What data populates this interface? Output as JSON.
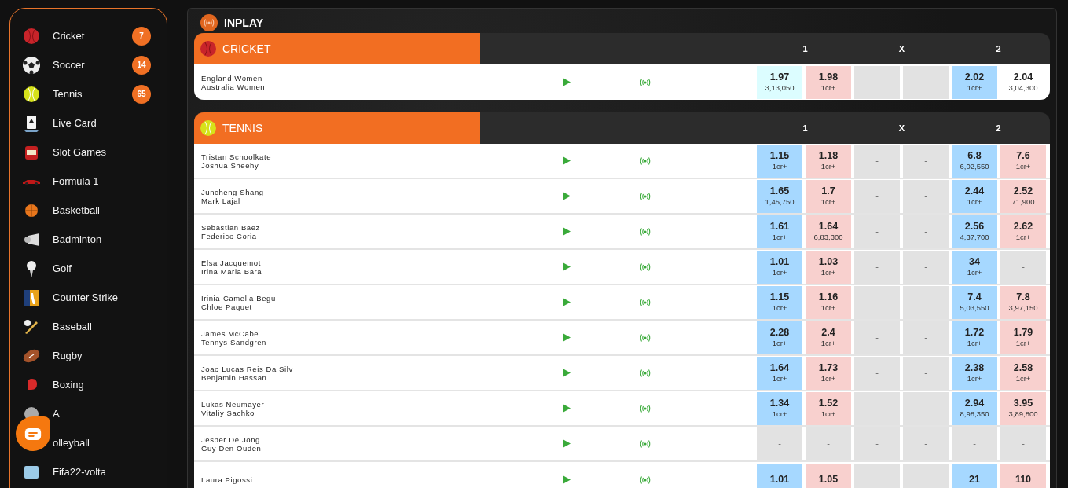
{
  "sidebar": {
    "items": [
      {
        "label": "Cricket",
        "count": "7"
      },
      {
        "label": "Soccer",
        "count": "14"
      },
      {
        "label": "Tennis",
        "count": "65"
      },
      {
        "label": "Live Card"
      },
      {
        "label": "Slot Games"
      },
      {
        "label": "Formula 1"
      },
      {
        "label": "Basketball"
      },
      {
        "label": "Badminton"
      },
      {
        "label": "Golf"
      },
      {
        "label": "Counter Strike"
      },
      {
        "label": "Baseball"
      },
      {
        "label": "Rugby"
      },
      {
        "label": "Boxing"
      },
      {
        "label": "A"
      },
      {
        "label": "olleyball"
      },
      {
        "label": "Fifa22-volta"
      }
    ]
  },
  "inplay": {
    "title": "INPLAY"
  },
  "sections": [
    {
      "title": "CRICKET",
      "columns": [
        "1",
        "X",
        "2"
      ],
      "events": [
        {
          "teams": [
            "England Women",
            "Australia Women"
          ],
          "odds": [
            {
              "kind": "back-light",
              "price": "1.97",
              "size": "3,13,050"
            },
            {
              "kind": "lay",
              "price": "1.98",
              "size": "1cr+"
            },
            {
              "kind": "empty",
              "price": "-"
            },
            {
              "kind": "empty",
              "price": "-"
            },
            {
              "kind": "back",
              "price": "2.02",
              "size": "1cr+"
            },
            {
              "kind": "plain",
              "price": "2.04",
              "size": "3,04,300"
            }
          ]
        }
      ]
    },
    {
      "title": "TENNIS",
      "columns": [
        "1",
        "X",
        "2"
      ],
      "events": [
        {
          "teams": [
            "Tristan Schoolkate",
            "Joshua Sheehy"
          ],
          "odds": [
            {
              "kind": "back",
              "price": "1.15",
              "size": "1cr+"
            },
            {
              "kind": "lay",
              "price": "1.18",
              "size": "1cr+"
            },
            {
              "kind": "empty",
              "price": "-"
            },
            {
              "kind": "empty",
              "price": "-"
            },
            {
              "kind": "back",
              "price": "6.8",
              "size": "6,02,550"
            },
            {
              "kind": "lay",
              "price": "7.6",
              "size": "1cr+"
            }
          ]
        },
        {
          "teams": [
            "Juncheng Shang",
            "Mark Lajal"
          ],
          "odds": [
            {
              "kind": "back",
              "price": "1.65",
              "size": "1,45,750"
            },
            {
              "kind": "lay",
              "price": "1.7",
              "size": "1cr+"
            },
            {
              "kind": "empty",
              "price": "-"
            },
            {
              "kind": "empty",
              "price": "-"
            },
            {
              "kind": "back",
              "price": "2.44",
              "size": "1cr+"
            },
            {
              "kind": "lay",
              "price": "2.52",
              "size": "71,900"
            }
          ]
        },
        {
          "teams": [
            "Sebastian Baez",
            "Federico Coria"
          ],
          "odds": [
            {
              "kind": "back",
              "price": "1.61",
              "size": "1cr+"
            },
            {
              "kind": "lay",
              "price": "1.64",
              "size": "6,83,300"
            },
            {
              "kind": "empty",
              "price": "-"
            },
            {
              "kind": "empty",
              "price": "-"
            },
            {
              "kind": "back",
              "price": "2.56",
              "size": "4,37,700"
            },
            {
              "kind": "lay",
              "price": "2.62",
              "size": "1cr+"
            }
          ]
        },
        {
          "teams": [
            "Elsa Jacquemot",
            "Irina Maria Bara"
          ],
          "odds": [
            {
              "kind": "back",
              "price": "1.01",
              "size": "1cr+"
            },
            {
              "kind": "lay",
              "price": "1.03",
              "size": "1cr+"
            },
            {
              "kind": "empty",
              "price": "-"
            },
            {
              "kind": "empty",
              "price": "-"
            },
            {
              "kind": "back",
              "price": "34",
              "size": "1cr+"
            },
            {
              "kind": "empty",
              "price": "-"
            }
          ]
        },
        {
          "teams": [
            "Irinia-Camelia Begu",
            "Chloe Paquet"
          ],
          "odds": [
            {
              "kind": "back",
              "price": "1.15",
              "size": "1cr+"
            },
            {
              "kind": "lay",
              "price": "1.16",
              "size": "1cr+"
            },
            {
              "kind": "empty",
              "price": "-"
            },
            {
              "kind": "empty",
              "price": "-"
            },
            {
              "kind": "back",
              "price": "7.4",
              "size": "5,03,550"
            },
            {
              "kind": "lay",
              "price": "7.8",
              "size": "3,97,150"
            }
          ]
        },
        {
          "teams": [
            "James McCabe",
            "Tennys Sandgren"
          ],
          "odds": [
            {
              "kind": "back",
              "price": "2.28",
              "size": "1cr+"
            },
            {
              "kind": "lay",
              "price": "2.4",
              "size": "1cr+"
            },
            {
              "kind": "empty",
              "price": "-"
            },
            {
              "kind": "empty",
              "price": "-"
            },
            {
              "kind": "back",
              "price": "1.72",
              "size": "1cr+"
            },
            {
              "kind": "lay",
              "price": "1.79",
              "size": "1cr+"
            }
          ]
        },
        {
          "teams": [
            "Joao Lucas Reis Da Silv",
            "Benjamin Hassan"
          ],
          "odds": [
            {
              "kind": "back",
              "price": "1.64",
              "size": "1cr+"
            },
            {
              "kind": "lay",
              "price": "1.73",
              "size": "1cr+"
            },
            {
              "kind": "empty",
              "price": "-"
            },
            {
              "kind": "empty",
              "price": "-"
            },
            {
              "kind": "back",
              "price": "2.38",
              "size": "1cr+"
            },
            {
              "kind": "lay",
              "price": "2.58",
              "size": "1cr+"
            }
          ]
        },
        {
          "teams": [
            "Lukas Neumayer",
            "Vitaliy Sachko"
          ],
          "odds": [
            {
              "kind": "back",
              "price": "1.34",
              "size": "1cr+"
            },
            {
              "kind": "lay",
              "price": "1.52",
              "size": "1cr+"
            },
            {
              "kind": "empty",
              "price": "-"
            },
            {
              "kind": "empty",
              "price": "-"
            },
            {
              "kind": "back",
              "price": "2.94",
              "size": "8,98,350"
            },
            {
              "kind": "lay",
              "price": "3.95",
              "size": "3,89,800"
            }
          ]
        },
        {
          "teams": [
            "Jesper De Jong",
            "Guy Den Ouden"
          ],
          "odds": [
            {
              "kind": "empty",
              "price": "-"
            },
            {
              "kind": "empty",
              "price": "-"
            },
            {
              "kind": "empty",
              "price": "-"
            },
            {
              "kind": "empty",
              "price": "-"
            },
            {
              "kind": "empty",
              "price": "-"
            },
            {
              "kind": "empty",
              "price": "-"
            }
          ]
        },
        {
          "teams": [
            "Laura Pigossi"
          ],
          "odds": [
            {
              "kind": "back",
              "price": "1.01"
            },
            {
              "kind": "lay",
              "price": "1.05"
            },
            {
              "kind": "empty"
            },
            {
              "kind": "empty"
            },
            {
              "kind": "back",
              "price": "21"
            },
            {
              "kind": "lay",
              "price": "110"
            }
          ]
        }
      ]
    }
  ]
}
